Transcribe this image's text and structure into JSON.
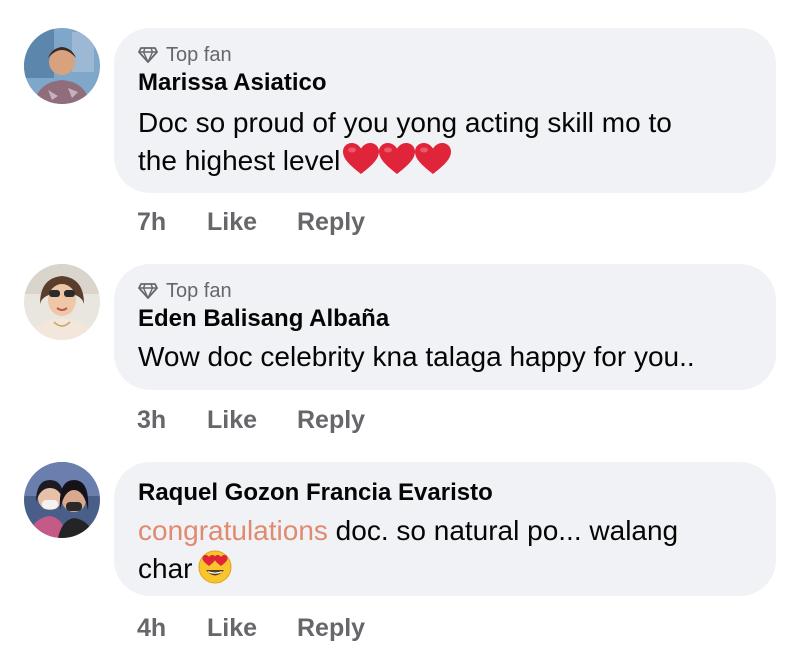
{
  "comments": [
    {
      "badge": "Top fan",
      "author": "Marissa Asiatico",
      "text_line1": "Doc so proud of you yong acting skill mo to",
      "text_line2": "the highest level",
      "reaction_icons": [
        "heart-icon",
        "heart-icon",
        "heart-icon"
      ],
      "time": "7h",
      "like_label": "Like",
      "reply_label": "Reply"
    },
    {
      "badge": "Top fan",
      "author": "Eden Balisang Albaña",
      "text_line1": "Wow doc celebrity kna talaga happy for you..",
      "time": "3h",
      "like_label": "Like",
      "reply_label": "Reply"
    },
    {
      "author": "Raquel Gozon Francia Evaristo",
      "text_highlight": "congratulations",
      "text_rest": " doc. so natural po... walang",
      "text_line2": "char",
      "reaction_icons": [
        "heart-eyes-emoji-icon"
      ],
      "time": "4h",
      "like_label": "Like",
      "reply_label": "Reply"
    }
  ],
  "colors": {
    "bubble": "#f0f2f5",
    "meta_text": "#65676b",
    "primary_text": "#050505",
    "highlight_text": "#e08a70",
    "heart": "#e0243a"
  }
}
